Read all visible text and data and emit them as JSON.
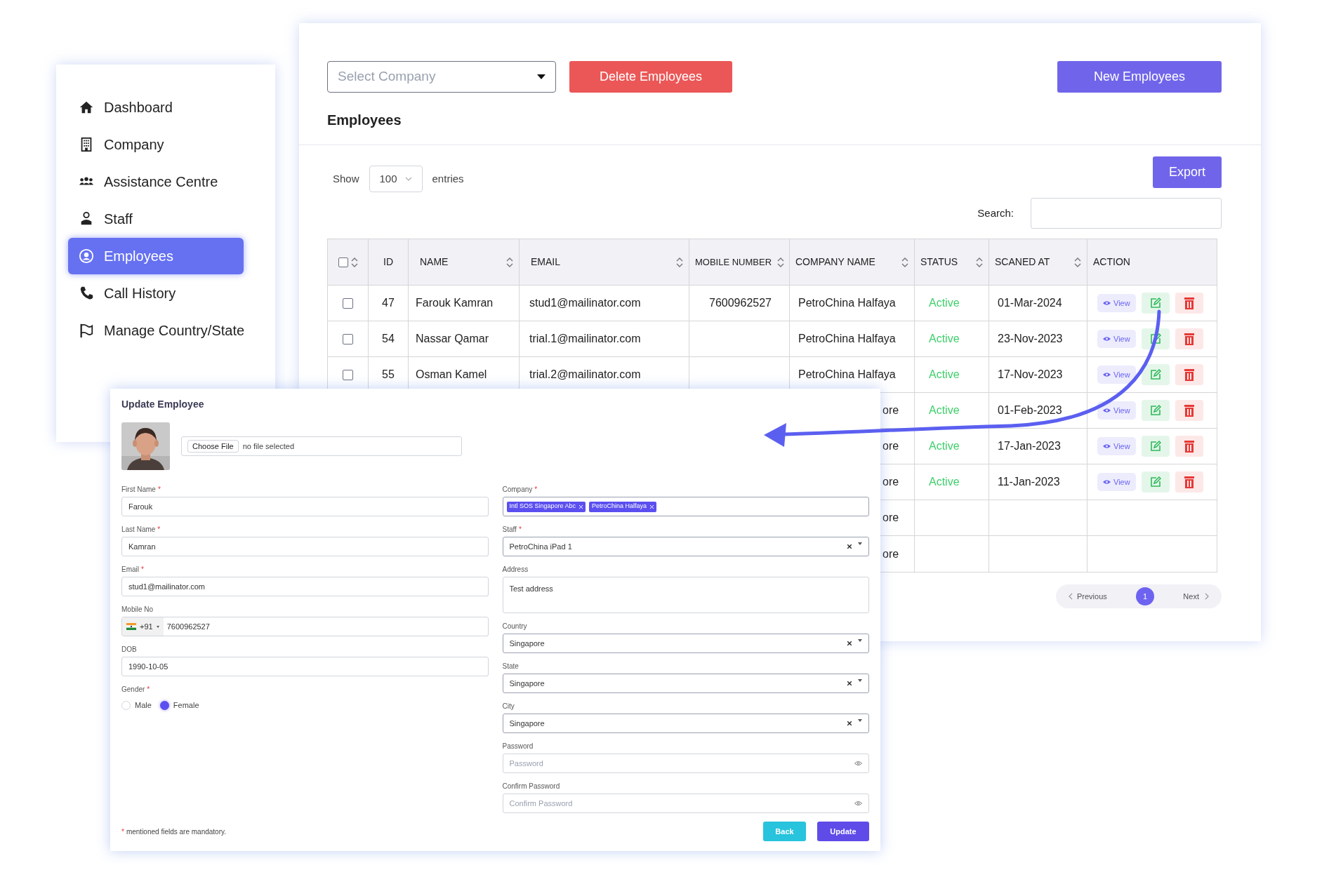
{
  "sidebar": {
    "items": [
      {
        "label": "Dashboard",
        "selected": false
      },
      {
        "label": "Company",
        "selected": false
      },
      {
        "label": "Assistance Centre",
        "selected": false
      },
      {
        "label": "Staff",
        "selected": false
      },
      {
        "label": "Employees",
        "selected": true
      },
      {
        "label": "Call History",
        "selected": false
      },
      {
        "label": "Manage Country/State",
        "selected": false
      }
    ]
  },
  "toolbar": {
    "company_select": {
      "placeholder": "Select Company"
    },
    "delete_button": "Delete Employees",
    "new_button": "New Employees"
  },
  "page_title": "Employees",
  "table_controls": {
    "show_label": "Show",
    "page_size": "100",
    "entries_label": "entries",
    "export_button": "Export",
    "search_label": "Search:"
  },
  "table": {
    "select_all": {
      "checked": false
    },
    "columns": [
      {
        "label": "ID",
        "sortable": false
      },
      {
        "label": "NAME",
        "sortable": true
      },
      {
        "label": "EMAIL",
        "sortable": true
      },
      {
        "label": "MOBILE NUMBER",
        "sortable": true
      },
      {
        "label": "COMPANY NAME",
        "sortable": true
      },
      {
        "label": "STATUS",
        "sortable": true
      },
      {
        "label": "SCANED AT",
        "sortable": true
      },
      {
        "label": "ACTION",
        "sortable": false
      }
    ],
    "rows": [
      {
        "checked": false,
        "id": "47",
        "name": "Farouk Kamran",
        "email": "stud1@mailinator.com",
        "mobile": "7600962527",
        "company": "PetroChina Halfaya",
        "status": "Active",
        "scaned_at": "01-Mar-2024",
        "view_label": "View"
      },
      {
        "checked": false,
        "id": "54",
        "name": "Nassar Qamar",
        "email": "trial.1@mailinator.com",
        "company": "PetroChina Halfaya",
        "status": "Active",
        "scaned_at": "23-Nov-2023",
        "view_label": "View"
      },
      {
        "checked": false,
        "id": "55",
        "name": "Osman Kamel",
        "email": "trial.2@mailinator.com",
        "company": "PetroChina Halfaya",
        "status": "Active",
        "scaned_at": "17-Nov-2023",
        "view_label": "View"
      },
      {
        "company": "ore",
        "status": "Active",
        "scaned_at": "01-Feb-2023",
        "view_label": "View"
      },
      {
        "company": "ore",
        "status": "Active",
        "scaned_at": "17-Jan-2023",
        "view_label": "View"
      },
      {
        "company": "ore",
        "status": "Active",
        "scaned_at": "11-Jan-2023",
        "view_label": "View"
      },
      {
        "company": "ore"
      },
      {
        "company": "ore"
      }
    ]
  },
  "pagination": {
    "previous": "Previous",
    "pages": [
      {
        "label": "1",
        "selected": true
      }
    ],
    "next": "Next"
  },
  "update_form": {
    "title": "Update Employee",
    "required_mark": "*",
    "file_input": {
      "button": "Choose File",
      "status": "no file selected"
    },
    "left_fields": [
      {
        "kind": "text",
        "label": "First Name",
        "required": true,
        "value": "Farouk"
      },
      {
        "kind": "text",
        "label": "Last Name",
        "required": true,
        "value": "Kamran"
      },
      {
        "kind": "text",
        "label": "Email",
        "required": true,
        "value": "stud1@mailinator.com"
      },
      {
        "kind": "phone",
        "label": "Mobile No",
        "required": false,
        "dial_code": "+91",
        "value": "7600962527"
      },
      {
        "kind": "text",
        "label": "DOB",
        "required": false,
        "value": "1990-10-05"
      },
      {
        "kind": "radio",
        "label": "Gender",
        "required": true,
        "options": [
          {
            "label": "Male",
            "selected": false
          },
          {
            "label": "Female",
            "selected": true
          }
        ]
      }
    ],
    "right_fields": [
      {
        "kind": "tags",
        "label": "Company",
        "required": true,
        "tags": [
          "Intl SOS Singapore Abc",
          "PetroChina Halfaya"
        ]
      },
      {
        "kind": "select",
        "label": "Staff",
        "required": true,
        "value": "PetroChina iPad 1"
      },
      {
        "kind": "textarea",
        "label": "Address",
        "required": false,
        "value": "Test address"
      },
      {
        "kind": "select",
        "label": "Country",
        "required": false,
        "value": "Singapore"
      },
      {
        "kind": "select",
        "label": "State",
        "required": false,
        "value": "Singapore"
      },
      {
        "kind": "select",
        "label": "City",
        "required": false,
        "value": "Singapore"
      },
      {
        "kind": "password",
        "label": "Password",
        "required": false,
        "placeholder": "Password"
      },
      {
        "kind": "password",
        "label": "Confirm Password",
        "required": false,
        "placeholder": "Confirm Password"
      }
    ],
    "mandatory_note": "mentioned fields are mandatory.",
    "back_button": "Back",
    "update_button": "Update"
  }
}
